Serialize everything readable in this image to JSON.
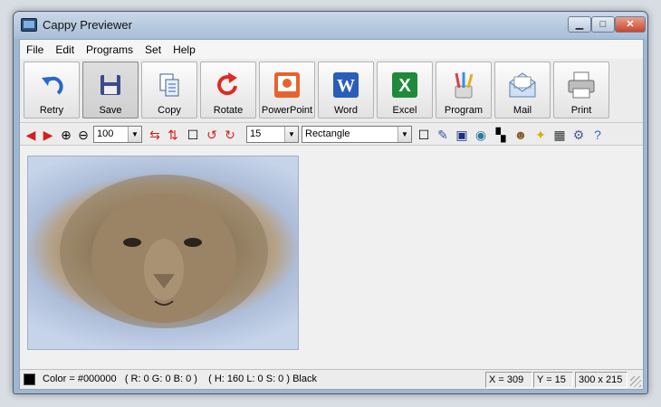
{
  "window": {
    "title": "Cappy Previewer"
  },
  "menu": [
    "File",
    "Edit",
    "Programs",
    "Set",
    "Help"
  ],
  "toolbar": {
    "retry": "Retry",
    "save": "Save",
    "copy": "Copy",
    "rotate": "Rotate",
    "powerpoint": "PowerPoint",
    "word": "Word",
    "excel": "Excel",
    "program": "Program",
    "mail": "Mail",
    "print": "Print"
  },
  "toolbar2": {
    "zoom": "100",
    "thickness": "15",
    "shape": "Rectangle"
  },
  "status": {
    "color_hex": "Color = #000000",
    "rgb": "( R: 0  G: 0  B: 0 )",
    "hsl_name": "( H: 160  L: 0  S: 0 ) Black",
    "x": "X = 309",
    "y": "Y = 15",
    "size": "300 x 215",
    "swatch_color": "#000000"
  }
}
